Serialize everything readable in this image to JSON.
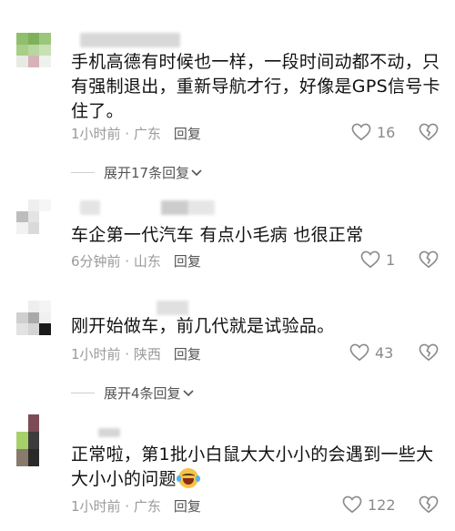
{
  "comments": [
    {
      "text": "手机高德有时候也一样，一段时间动都不动，只有强制退出，重新导航才行，好像是GPS信号卡住了。",
      "time_location": "1小时前 · 广东",
      "reply_label": "回复",
      "likes": "16"
    },
    {
      "text": "车企第一代汽车 有点小毛病 也很正常",
      "time_location": "6分钟前 · 山东",
      "reply_label": "回复",
      "likes": "1"
    },
    {
      "text": "刚开始做车，前几代就是试验品。",
      "time_location": "1小时前 · 陕西",
      "reply_label": "回复",
      "likes": "43"
    },
    {
      "text": "正常啦，第1批小白鼠大大小小的会遇到一些大大小小的问题",
      "time_location": "1小时前 · 广东",
      "reply_label": "回复",
      "likes": "122"
    }
  ],
  "expand_replies": [
    {
      "label": "展开17条回复"
    },
    {
      "label": "展开4条回复"
    }
  ],
  "icons": {
    "like": "heart-outline-icon",
    "dislike": "broken-heart-icon",
    "expand": "chevron-down-icon",
    "emoji": "rofl-emoji"
  },
  "colors": {
    "text": "#111111",
    "meta": "#9a9a9a",
    "reply": "#555555",
    "icon": "#8a8a8a"
  }
}
